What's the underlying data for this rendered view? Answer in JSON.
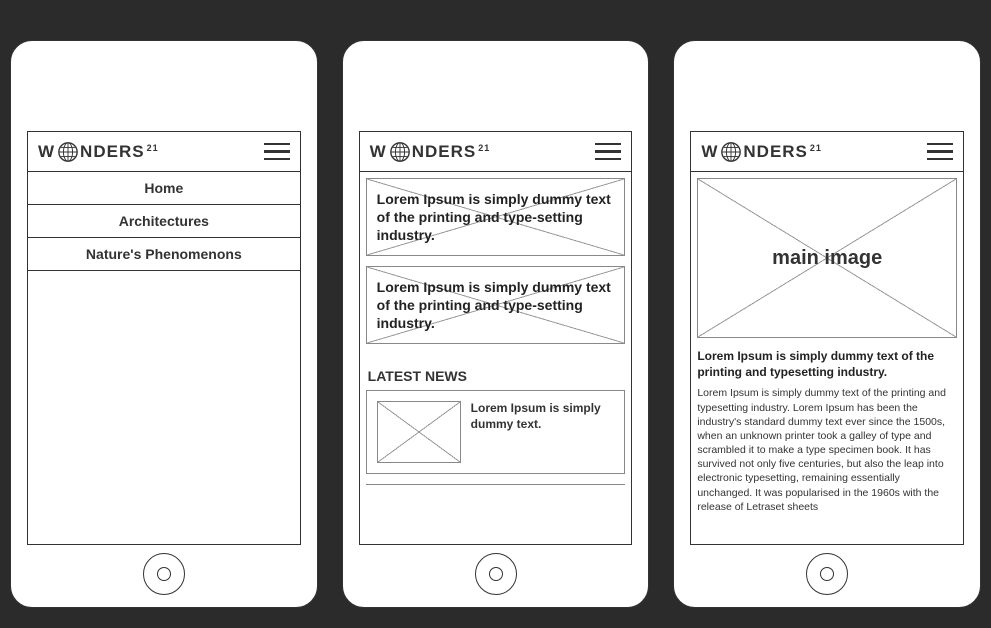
{
  "brand": {
    "name_left": "W",
    "name_right": "NDERS",
    "super": "21"
  },
  "menu": {
    "items": [
      {
        "label": "Home"
      },
      {
        "label": "Architectures"
      },
      {
        "label": "Nature's Phenomenons"
      }
    ]
  },
  "feed": {
    "cards": [
      {
        "text": "Lorem Ipsum is simply dummy text of the printing and type-setting industry."
      },
      {
        "text": "Lorem Ipsum is simply dummy text of the printing and type-setting industry."
      }
    ],
    "section_title": "LATEST NEWS",
    "news_item": {
      "text": "Lorem Ipsum is simply dummy text."
    }
  },
  "article": {
    "main_image_label": "main image",
    "headline": "Lorem Ipsum is simply dummy text of the printing and typesetting industry.",
    "body": "Lorem Ipsum is simply dummy text of the printing and typesetting industry. Lorem Ipsum has been the industry's standard dummy text ever since the 1500s, when an unknown printer took a galley of type and scrambled it to make a type specimen book. It has survived not only five centuries, but also the leap into electronic typesetting, remaining essentially unchanged. It was popularised in the 1960s with the release of Letraset sheets"
  }
}
